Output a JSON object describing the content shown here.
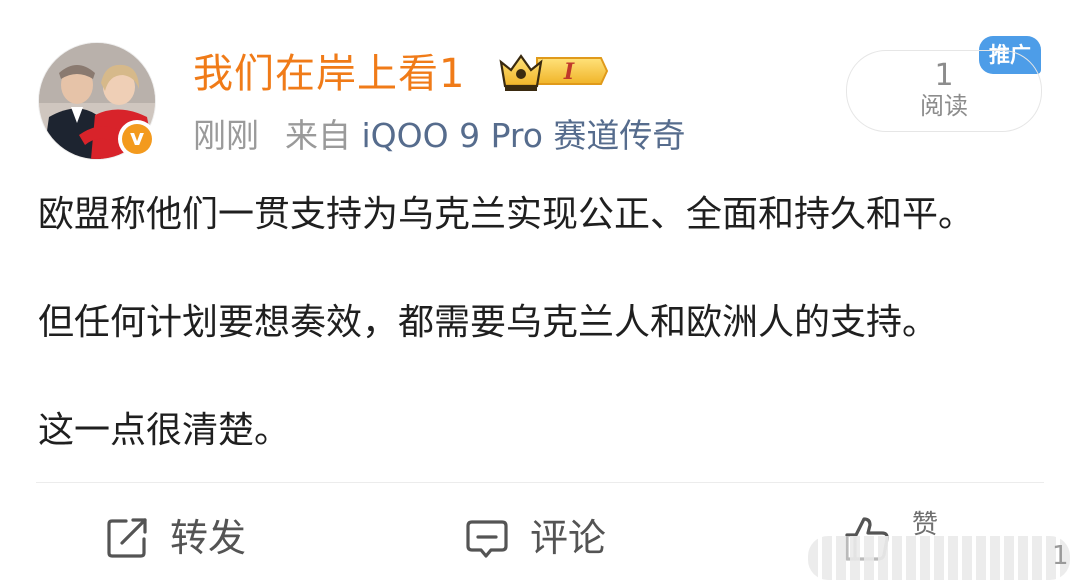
{
  "post": {
    "username": "我们在岸上看1",
    "crown_badge": "I",
    "avatar_verified_label": "v",
    "time": "刚刚",
    "source_prefix": "来自",
    "source_device": "iQOO 9 Pro 赛道传奇",
    "read_count": "1",
    "read_label": "阅读",
    "promo_tag": "推广",
    "paragraphs": [
      "欧盟称他们一贯支持为乌克兰实现公正、全面和持久和平。",
      "但任何计划要想奏效，都需要乌克兰人和欧洲人的支持。",
      "这一点很清楚。"
    ]
  },
  "actions": {
    "repost_label": "转发",
    "comment_label": "评论",
    "like_label": "赞",
    "like_count": "1"
  },
  "colors": {
    "username": "#f07b18",
    "source": "#566c8d",
    "meta": "#9a9a9a",
    "promo": "#4d9de8",
    "verified": "#f39a1e",
    "text": "#1f1f1f"
  },
  "icons": [
    "verified-badge-icon",
    "crown-level-icon",
    "repost-icon",
    "comment-icon",
    "like-icon"
  ]
}
